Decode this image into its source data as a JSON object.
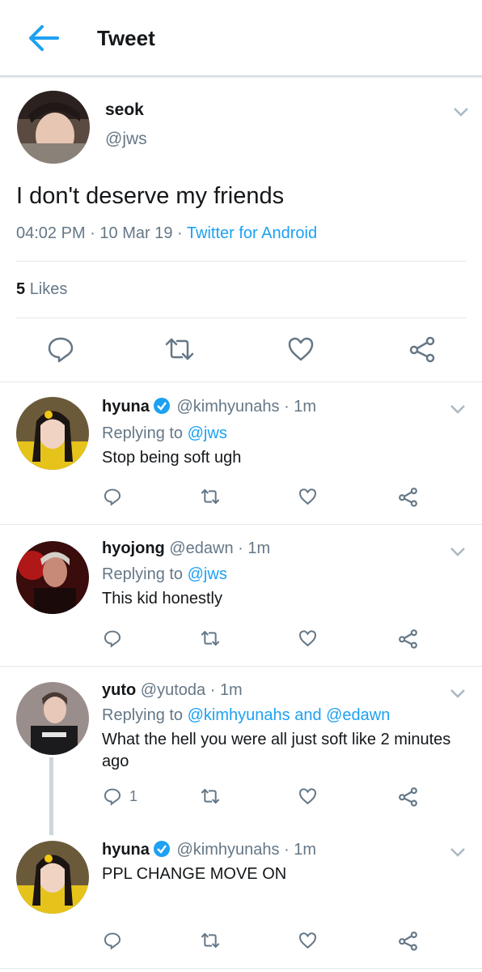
{
  "header": {
    "title": "Tweet"
  },
  "main": {
    "name": "seok",
    "handle": "@jws",
    "text": "I don't deserve my friends",
    "time": "04:02 PM",
    "date": "10 Mar 19",
    "source": "Twitter for Android",
    "like_count": "5",
    "likes_label": "Likes"
  },
  "replies": [
    {
      "name": "hyuna",
      "handle": "@kimhyunahs",
      "time": "1m",
      "replying_prefix": "Replying to",
      "replying_to": "@jws",
      "text": "Stop being soft ugh"
    },
    {
      "name": "hyojong",
      "handle": "@edawn",
      "time": "1m",
      "replying_prefix": "Replying to",
      "replying_to": "@jws",
      "text": "This kid honestly"
    },
    {
      "name": "yuto",
      "handle": "@yutoda",
      "time": "1m",
      "replying_prefix": "Replying to",
      "replying_to": "@kimhyunahs and @edawn",
      "text": "What the hell you were all just soft like 2 minutes ago",
      "reply_count": "1"
    },
    {
      "name": "hyuna",
      "handle": "@kimhyunahs",
      "time": "1m",
      "text": "PPL CHANGE MOVE ON"
    }
  ],
  "colors": {
    "accent": "#1da1f2",
    "muted": "#657786",
    "text": "#14171a"
  },
  "icons": [
    "back-arrow-icon",
    "chevron-down-icon",
    "reply-icon",
    "retweet-icon",
    "like-icon",
    "share-icon",
    "verified-icon"
  ]
}
